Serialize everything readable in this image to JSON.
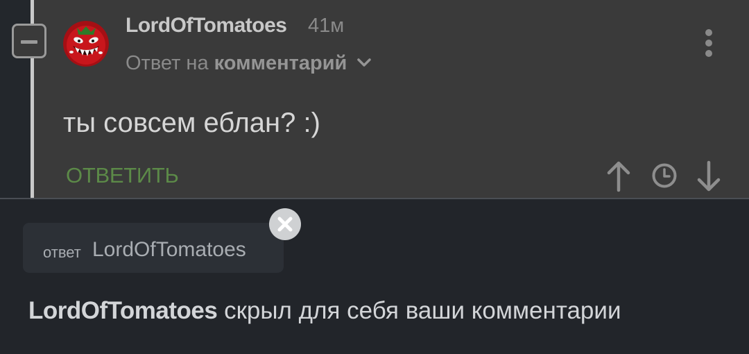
{
  "comment": {
    "author": "LordOfTomatoes",
    "time_ago": "41м",
    "reply_prefix": "Ответ на",
    "reply_link": "комментарий",
    "text": "ты совсем еблан? :)",
    "reply_button": "ОТВЕТИТЬ",
    "icons": {
      "collapse": "minus-square-icon",
      "expand_reply": "chevron-down-icon",
      "more": "more-vertical-icon",
      "vote_up": "arrow-up-icon",
      "history": "clock-icon",
      "vote_down": "arrow-down-icon"
    }
  },
  "reply_chip": {
    "prefix": "ответ",
    "name": "LordOfTomatoes",
    "close_icon": "close-icon"
  },
  "notice": {
    "user": "LordOfTomatoes",
    "text": " скрыл для себя ваши комментарии"
  },
  "colors": {
    "card_bg": "#3a3a3a",
    "panel_bg": "#22252a",
    "accent_green": "#5c8a48",
    "avatar_red": "#c8161c"
  }
}
